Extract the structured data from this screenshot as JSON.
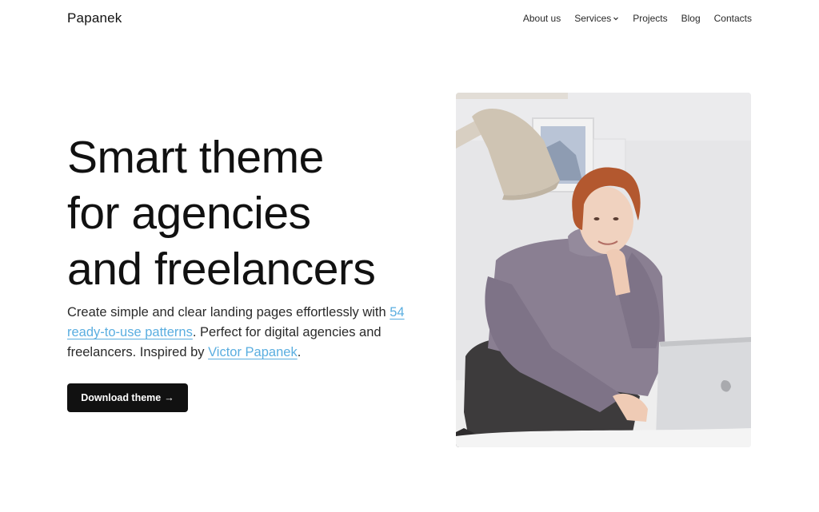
{
  "header": {
    "logo": "Papanek",
    "nav": [
      {
        "label": "About us"
      },
      {
        "label": "Services",
        "has_dropdown": true
      },
      {
        "label": "Projects"
      },
      {
        "label": "Blog"
      },
      {
        "label": "Contacts"
      }
    ]
  },
  "hero": {
    "title_lines": [
      "Smart theme",
      "for agencies",
      "and freelancers"
    ],
    "description": {
      "part1": "Create simple and clear landing pages effortlessly with ",
      "link1": "54 ready-to-use patterns",
      "part2": ". Perfect for digital agencies and freelancers. Inspired by ",
      "link2": "Victor Papanek",
      "part3": "."
    },
    "cta_label": "Download theme",
    "cta_arrow": "→"
  },
  "image": {
    "subject": "woman-with-laptop-photo"
  },
  "colors": {
    "link": "#5aaee0",
    "button_bg": "#111111",
    "text": "#111111"
  }
}
